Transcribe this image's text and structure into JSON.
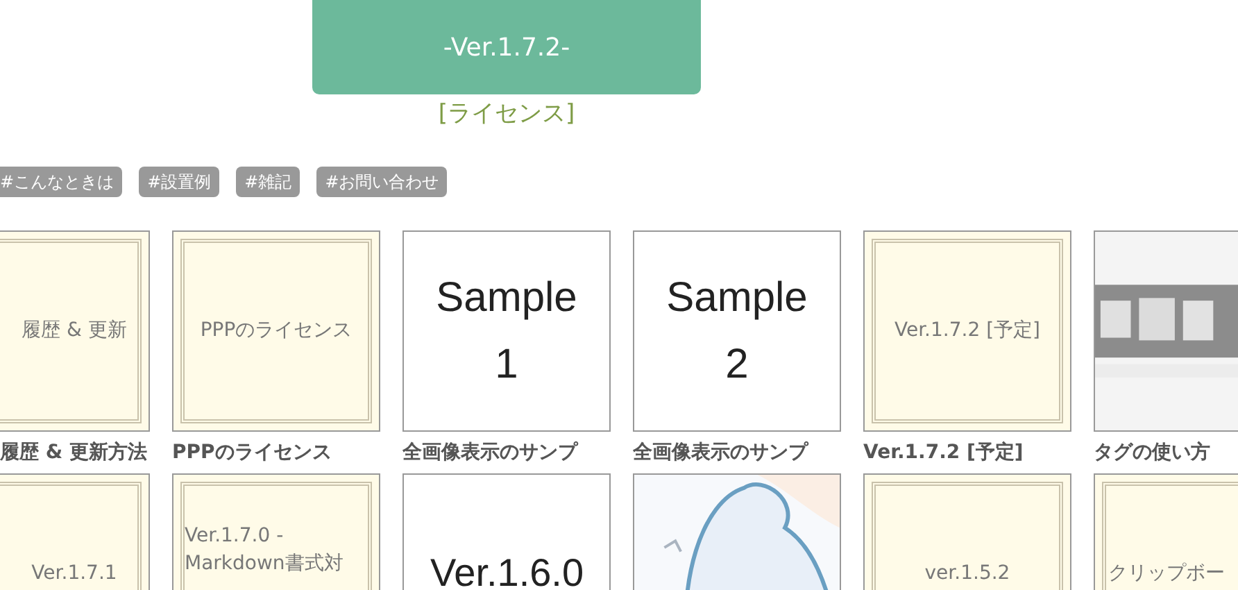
{
  "header": {
    "version": "-Ver.1.7.2-",
    "license_link": "[ライセンス]"
  },
  "tags": [
    "#こんなときは",
    "#設置例",
    "#雑記",
    "#お問い合わせ"
  ],
  "rows": [
    [
      {
        "kind": "frame",
        "text": "履歴 & 更新",
        "caption": "履歴 & 更新方法"
      },
      {
        "kind": "frame",
        "text": "PPPのライセンス",
        "caption": "PPPのライセンス"
      },
      {
        "kind": "sample",
        "text": "Sample 1",
        "caption": "全画像表示のサンプ"
      },
      {
        "kind": "sample",
        "text": "Sample 2",
        "caption": "全画像表示のサンプ"
      },
      {
        "kind": "frame",
        "text": "Ver.1.7.2 [予定]",
        "caption": "Ver.1.7.2 [予定]"
      },
      {
        "kind": "picture",
        "caption": "タグの使い方"
      }
    ],
    [
      {
        "kind": "frame",
        "text": "Ver.1.7.1"
      },
      {
        "kind": "frame",
        "text": "Ver.1.7.0 - Markdown書式対"
      },
      {
        "kind": "sample",
        "text": "Ver.1.6.0"
      },
      {
        "kind": "picture"
      },
      {
        "kind": "frame",
        "text": "ver.1.5.2"
      },
      {
        "kind": "frame",
        "text": "クリップボー"
      }
    ]
  ]
}
